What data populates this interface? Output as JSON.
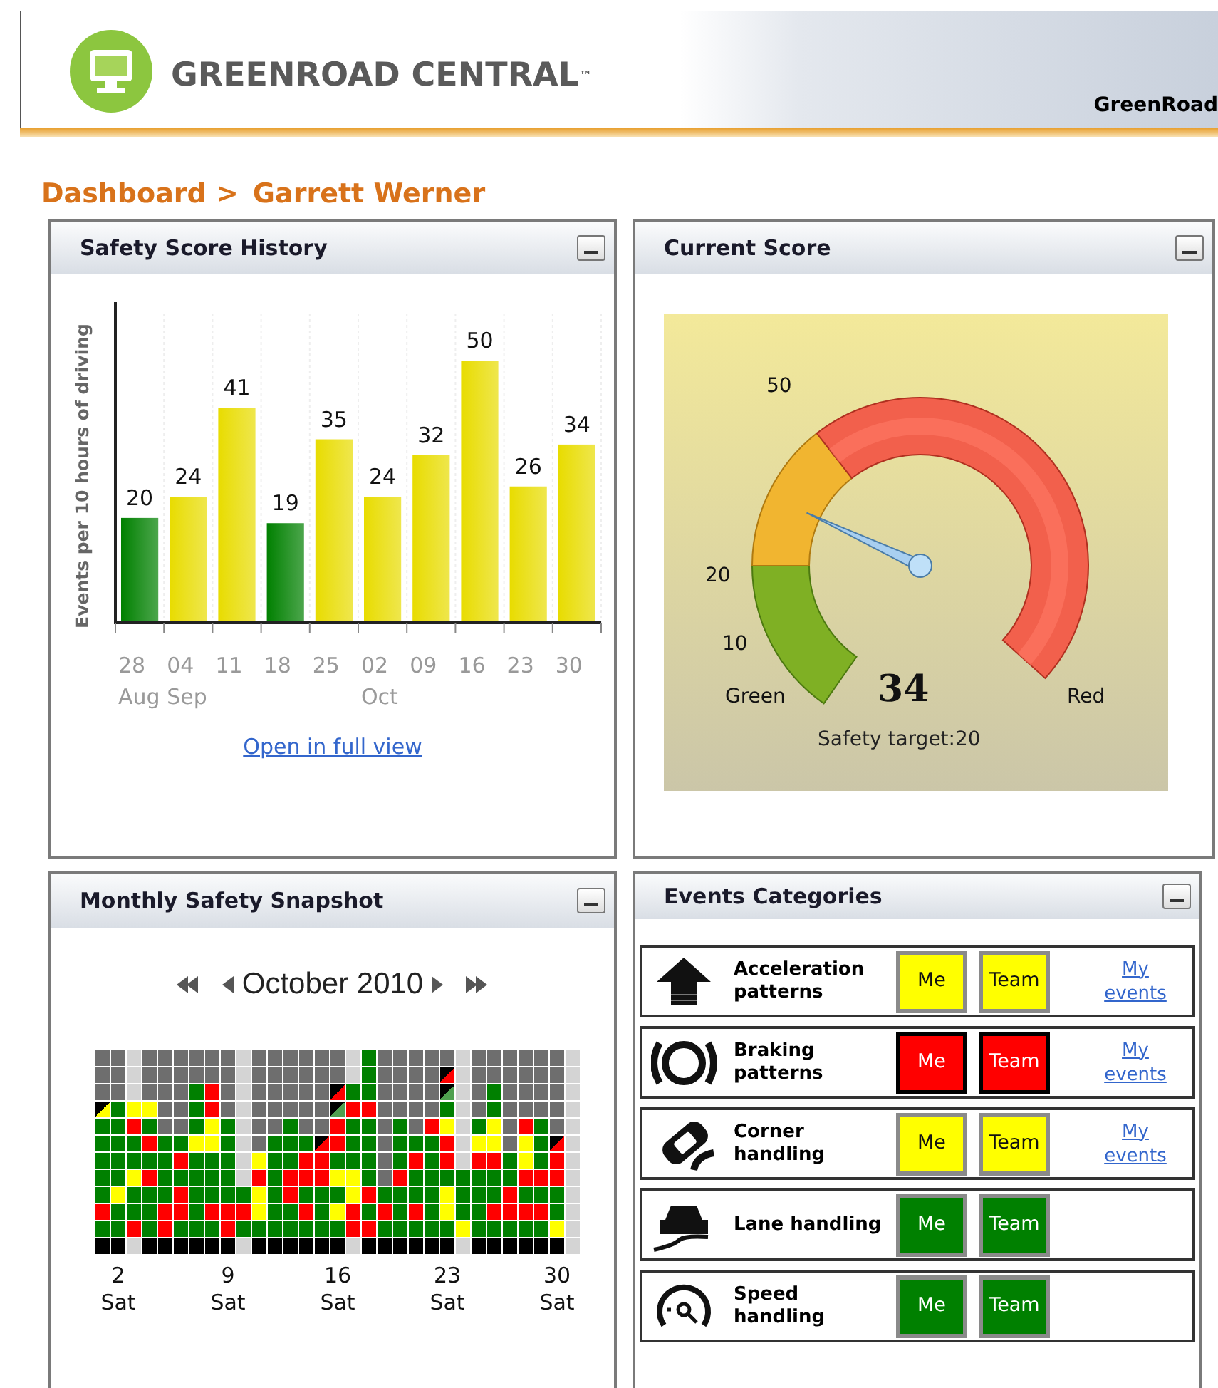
{
  "header": {
    "logo_text": "GREENROAD CENTRAL",
    "trademark": "™",
    "account": "GreenRoad"
  },
  "breadcrumb": [
    "Dashboard >",
    "Garrett Werner"
  ],
  "safety_score_history": {
    "title": "Safety Score History",
    "link": "Open in full view",
    "chart_data": {
      "type": "bar",
      "ylabel": "Events per 10 hours of driving",
      "categories": [
        "28\nAug",
        "04\nSep",
        "11",
        "18",
        "25",
        "02\nOct",
        "09",
        "16",
        "23",
        "30"
      ],
      "data_labels": true,
      "ylim": [
        0,
        59
      ],
      "series": [
        {
          "color": "#008000",
          "values": [
            20,
            null,
            null,
            19,
            null,
            null,
            null,
            null,
            null,
            null
          ]
        },
        {
          "color": "#e8dc00",
          "values": [
            null,
            24,
            41,
            null,
            35,
            24,
            32,
            50,
            26,
            34
          ]
        }
      ]
    }
  },
  "current_score": {
    "title": "Current Score",
    "ticks": [
      {
        "label": "50"
      },
      {
        "label": "20"
      },
      {
        "label": "10"
      }
    ],
    "left_label": "Green",
    "right_label": "Red",
    "score": "34",
    "target": "Safety target:20"
  },
  "monthly_snapshot": {
    "title": "Monthly Safety Snapshot",
    "month": "October 2010",
    "rows": [
      [
        {
          "color": "#6e6e6e"
        },
        {
          "color": "#6e6e6e"
        },
        {
          "color": "#d4d4d4"
        },
        {
          "color": "#6e6e6e"
        },
        {
          "color": "#6e6e6e"
        },
        {
          "color": "#6e6e6e"
        },
        {
          "color": "#6e6e6e"
        },
        {
          "color": "#6e6e6e"
        },
        {
          "color": "#6e6e6e"
        },
        {
          "color": "#d4d4d4"
        },
        {
          "color": "#6e6e6e"
        },
        {
          "color": "#6e6e6e"
        },
        {
          "color": "#6e6e6e"
        },
        {
          "color": "#6e6e6e"
        },
        {
          "color": "#6e6e6e"
        },
        {
          "color": "#6e6e6e"
        },
        {
          "color": "#d4d4d4"
        },
        {
          "color": "#008000"
        },
        {
          "color": "#6e6e6e"
        },
        {
          "color": "#6e6e6e"
        },
        {
          "color": "#6e6e6e"
        },
        {
          "color": "#6e6e6e"
        },
        {
          "color": "#6e6e6e"
        },
        {
          "color": "#d4d4d4"
        },
        {
          "color": "#6e6e6e"
        },
        {
          "color": "#6e6e6e"
        },
        {
          "color": "#6e6e6e"
        },
        {
          "color": "#6e6e6e"
        },
        {
          "color": "#6e6e6e"
        },
        {
          "color": "#6e6e6e"
        },
        {
          "color": "#d4d4d4"
        }
      ],
      [
        {
          "color": "#6e6e6e"
        },
        {
          "color": "#6e6e6e"
        },
        {
          "color": "#d4d4d4"
        },
        {
          "color": "#6e6e6e"
        },
        {
          "color": "#6e6e6e"
        },
        {
          "color": "#6e6e6e"
        },
        {
          "color": "#6e6e6e"
        },
        {
          "color": "#6e6e6e"
        },
        {
          "color": "#6e6e6e"
        },
        {
          "color": "#d4d4d4"
        },
        {
          "color": "#6e6e6e"
        },
        {
          "color": "#6e6e6e"
        },
        {
          "color": "#6e6e6e"
        },
        {
          "color": "#6e6e6e"
        },
        {
          "color": "#6e6e6e"
        },
        {
          "color": "#6e6e6e"
        },
        {
          "color": "#d4d4d4"
        },
        {
          "color": "#008000"
        },
        {
          "color": "#6e6e6e"
        },
        {
          "color": "#6e6e6e"
        },
        {
          "color": "#6e6e6e"
        },
        {
          "color": "#6e6e6e"
        },
        {
          "color": "#ff0000",
          "corner": true
        },
        {
          "color": "#d4d4d4"
        },
        {
          "color": "#6e6e6e"
        },
        {
          "color": "#6e6e6e"
        },
        {
          "color": "#6e6e6e"
        },
        {
          "color": "#6e6e6e"
        },
        {
          "color": "#6e6e6e"
        },
        {
          "color": "#6e6e6e"
        },
        {
          "color": "#d4d4d4"
        }
      ],
      [
        {
          "color": "#6e6e6e"
        },
        {
          "color": "#6e6e6e"
        },
        {
          "color": "#d4d4d4"
        },
        {
          "color": "#6e6e6e"
        },
        {
          "color": "#6e6e6e"
        },
        {
          "color": "#6e6e6e"
        },
        {
          "color": "#008000"
        },
        {
          "color": "#ff0000"
        },
        {
          "color": "#6e6e6e"
        },
        {
          "color": "#d4d4d4"
        },
        {
          "color": "#6e6e6e"
        },
        {
          "color": "#6e6e6e"
        },
        {
          "color": "#6e6e6e"
        },
        {
          "color": "#6e6e6e"
        },
        {
          "color": "#6e6e6e"
        },
        {
          "color": "#ff0000",
          "corner": true
        },
        {
          "color": "#008000"
        },
        {
          "color": "#008000"
        },
        {
          "color": "#6e6e6e"
        },
        {
          "color": "#6e6e6e"
        },
        {
          "color": "#6e6e6e"
        },
        {
          "color": "#6e6e6e"
        },
        {
          "color": "#50a050",
          "corner": true
        },
        {
          "color": "#d4d4d4"
        },
        {
          "color": "#6e6e6e"
        },
        {
          "color": "#008000"
        },
        {
          "color": "#6e6e6e"
        },
        {
          "color": "#6e6e6e"
        },
        {
          "color": "#6e6e6e"
        },
        {
          "color": "#6e6e6e"
        },
        {
          "color": "#d4d4d4"
        }
      ],
      [
        {
          "color": "#ffff00",
          "corner": true
        },
        {
          "color": "#008000"
        },
        {
          "color": "#ffff00"
        },
        {
          "color": "#ffff00"
        },
        {
          "color": "#6e6e6e"
        },
        {
          "color": "#6e6e6e"
        },
        {
          "color": "#008000"
        },
        {
          "color": "#ff0000"
        },
        {
          "color": "#6e6e6e"
        },
        {
          "color": "#d4d4d4"
        },
        {
          "color": "#6e6e6e"
        },
        {
          "color": "#6e6e6e"
        },
        {
          "color": "#6e6e6e"
        },
        {
          "color": "#6e6e6e"
        },
        {
          "color": "#6e6e6e"
        },
        {
          "color": "#50a050",
          "corner": true
        },
        {
          "color": "#ff0000"
        },
        {
          "color": "#ff0000"
        },
        {
          "color": "#6e6e6e"
        },
        {
          "color": "#6e6e6e"
        },
        {
          "color": "#6e6e6e"
        },
        {
          "color": "#6e6e6e"
        },
        {
          "color": "#008000"
        },
        {
          "color": "#d4d4d4"
        },
        {
          "color": "#6e6e6e"
        },
        {
          "color": "#008000"
        },
        {
          "color": "#6e6e6e"
        },
        {
          "color": "#6e6e6e"
        },
        {
          "color": "#6e6e6e"
        },
        {
          "color": "#6e6e6e"
        },
        {
          "color": "#d4d4d4"
        }
      ],
      [
        {
          "color": "#008000"
        },
        {
          "color": "#008000"
        },
        {
          "color": "#ff0000"
        },
        {
          "color": "#008000"
        },
        {
          "color": "#6e6e6e"
        },
        {
          "color": "#6e6e6e"
        },
        {
          "color": "#008000"
        },
        {
          "color": "#ffff00"
        },
        {
          "color": "#008000"
        },
        {
          "color": "#d4d4d4"
        },
        {
          "color": "#6e6e6e"
        },
        {
          "color": "#6e6e6e"
        },
        {
          "color": "#008000"
        },
        {
          "color": "#6e6e6e"
        },
        {
          "color": "#6e6e6e"
        },
        {
          "color": "#ff0000"
        },
        {
          "color": "#008000"
        },
        {
          "color": "#008000"
        },
        {
          "color": "#6e6e6e"
        },
        {
          "color": "#008000"
        },
        {
          "color": "#6e6e6e"
        },
        {
          "color": "#ff0000"
        },
        {
          "color": "#ffff00"
        },
        {
          "color": "#d4d4d4"
        },
        {
          "color": "#008000"
        },
        {
          "color": "#ffff00"
        },
        {
          "color": "#6e6e6e"
        },
        {
          "color": "#ff0000"
        },
        {
          "color": "#008000"
        },
        {
          "color": "#6e6e6e"
        },
        {
          "color": "#d4d4d4"
        }
      ],
      [
        {
          "color": "#008000"
        },
        {
          "color": "#008000"
        },
        {
          "color": "#008000"
        },
        {
          "color": "#ff0000"
        },
        {
          "color": "#008000"
        },
        {
          "color": "#008000"
        },
        {
          "color": "#ffff00"
        },
        {
          "color": "#ffff00"
        },
        {
          "color": "#008000"
        },
        {
          "color": "#d4d4d4"
        },
        {
          "color": "#6e6e6e"
        },
        {
          "color": "#008000"
        },
        {
          "color": "#008000"
        },
        {
          "color": "#008000"
        },
        {
          "color": "#ff0000",
          "corner": true
        },
        {
          "color": "#ff0000"
        },
        {
          "color": "#008000"
        },
        {
          "color": "#008000"
        },
        {
          "color": "#6e6e6e"
        },
        {
          "color": "#008000"
        },
        {
          "color": "#008000"
        },
        {
          "color": "#008000"
        },
        {
          "color": "#ff0000"
        },
        {
          "color": "#d4d4d4"
        },
        {
          "color": "#ffff00"
        },
        {
          "color": "#ffff00"
        },
        {
          "color": "#6e6e6e"
        },
        {
          "color": "#ffff00"
        },
        {
          "color": "#008000"
        },
        {
          "color": "#ff0000",
          "corner": true
        },
        {
          "color": "#d4d4d4"
        }
      ],
      [
        {
          "color": "#008000"
        },
        {
          "color": "#008000"
        },
        {
          "color": "#008000"
        },
        {
          "color": "#008000"
        },
        {
          "color": "#008000"
        },
        {
          "color": "#ff0000"
        },
        {
          "color": "#008000"
        },
        {
          "color": "#008000"
        },
        {
          "color": "#008000"
        },
        {
          "color": "#d4d4d4"
        },
        {
          "color": "#ffff00"
        },
        {
          "color": "#008000"
        },
        {
          "color": "#008000"
        },
        {
          "color": "#ff0000"
        },
        {
          "color": "#ff0000"
        },
        {
          "color": "#008000"
        },
        {
          "color": "#008000"
        },
        {
          "color": "#008000"
        },
        {
          "color": "#6e6e6e"
        },
        {
          "color": "#008000"
        },
        {
          "color": "#ff0000"
        },
        {
          "color": "#008000"
        },
        {
          "color": "#ff0000"
        },
        {
          "color": "#d4d4d4"
        },
        {
          "color": "#ff0000"
        },
        {
          "color": "#ff0000"
        },
        {
          "color": "#008000"
        },
        {
          "color": "#ffff00"
        },
        {
          "color": "#008000"
        },
        {
          "color": "#ff0000"
        },
        {
          "color": "#d4d4d4"
        }
      ],
      [
        {
          "color": "#008000"
        },
        {
          "color": "#008000"
        },
        {
          "color": "#ffff00"
        },
        {
          "color": "#ff0000"
        },
        {
          "color": "#008000"
        },
        {
          "color": "#008000"
        },
        {
          "color": "#008000"
        },
        {
          "color": "#008000"
        },
        {
          "color": "#008000"
        },
        {
          "color": "#d4d4d4"
        },
        {
          "color": "#ff0000"
        },
        {
          "color": "#008000"
        },
        {
          "color": "#ff0000"
        },
        {
          "color": "#ff0000"
        },
        {
          "color": "#ff0000"
        },
        {
          "color": "#ffff00"
        },
        {
          "color": "#ffff00"
        },
        {
          "color": "#008000"
        },
        {
          "color": "#6e6e6e"
        },
        {
          "color": "#ff0000"
        },
        {
          "color": "#008000"
        },
        {
          "color": "#008000"
        },
        {
          "color": "#008000"
        },
        {
          "color": "#008000"
        },
        {
          "color": "#008000"
        },
        {
          "color": "#008000"
        },
        {
          "color": "#008000"
        },
        {
          "color": "#ff0000"
        },
        {
          "color": "#ff0000"
        },
        {
          "color": "#ff0000"
        },
        {
          "color": "#d4d4d4"
        }
      ],
      [
        {
          "color": "#008000"
        },
        {
          "color": "#ffff00"
        },
        {
          "color": "#008000"
        },
        {
          "color": "#008000"
        },
        {
          "color": "#008000"
        },
        {
          "color": "#ff0000"
        },
        {
          "color": "#008000"
        },
        {
          "color": "#008000"
        },
        {
          "color": "#008000"
        },
        {
          "color": "#008000"
        },
        {
          "color": "#ffff00"
        },
        {
          "color": "#008000"
        },
        {
          "color": "#ff0000"
        },
        {
          "color": "#008000"
        },
        {
          "color": "#008000"
        },
        {
          "color": "#008000"
        },
        {
          "color": "#ffff00"
        },
        {
          "color": "#ff0000"
        },
        {
          "color": "#008000"
        },
        {
          "color": "#008000"
        },
        {
          "color": "#008000"
        },
        {
          "color": "#008000"
        },
        {
          "color": "#ffff00"
        },
        {
          "color": "#008000"
        },
        {
          "color": "#008000"
        },
        {
          "color": "#008000"
        },
        {
          "color": "#ff0000"
        },
        {
          "color": "#008000"
        },
        {
          "color": "#008000"
        },
        {
          "color": "#008000"
        },
        {
          "color": "#d4d4d4"
        }
      ],
      [
        {
          "color": "#ff0000"
        },
        {
          "color": "#008000"
        },
        {
          "color": "#008000"
        },
        {
          "color": "#008000"
        },
        {
          "color": "#ff0000"
        },
        {
          "color": "#ff0000"
        },
        {
          "color": "#008000"
        },
        {
          "color": "#ff0000"
        },
        {
          "color": "#ff0000"
        },
        {
          "color": "#ff0000"
        },
        {
          "color": "#ffff00"
        },
        {
          "color": "#008000"
        },
        {
          "color": "#008000"
        },
        {
          "color": "#ff0000"
        },
        {
          "color": "#008000"
        },
        {
          "color": "#ffff00"
        },
        {
          "color": "#ff0000"
        },
        {
          "color": "#008000"
        },
        {
          "color": "#ff0000"
        },
        {
          "color": "#008000"
        },
        {
          "color": "#ff0000"
        },
        {
          "color": "#008000"
        },
        {
          "color": "#ffff00"
        },
        {
          "color": "#008000"
        },
        {
          "color": "#008000"
        },
        {
          "color": "#ff0000"
        },
        {
          "color": "#ff0000"
        },
        {
          "color": "#ff0000"
        },
        {
          "color": "#ff0000"
        },
        {
          "color": "#008000"
        },
        {
          "color": "#d4d4d4"
        }
      ],
      [
        {
          "color": "#008000"
        },
        {
          "color": "#008000"
        },
        {
          "color": "#ff0000"
        },
        {
          "color": "#008000"
        },
        {
          "color": "#ff0000"
        },
        {
          "color": "#008000"
        },
        {
          "color": "#008000"
        },
        {
          "color": "#008000"
        },
        {
          "color": "#ff0000"
        },
        {
          "color": "#008000"
        },
        {
          "color": "#008000"
        },
        {
          "color": "#008000"
        },
        {
          "color": "#008000"
        },
        {
          "color": "#008000"
        },
        {
          "color": "#008000"
        },
        {
          "color": "#008000"
        },
        {
          "color": "#ff0000"
        },
        {
          "color": "#ff0000"
        },
        {
          "color": "#008000"
        },
        {
          "color": "#008000"
        },
        {
          "color": "#008000"
        },
        {
          "color": "#008000"
        },
        {
          "color": "#008000"
        },
        {
          "color": "#ffff00"
        },
        {
          "color": "#008000"
        },
        {
          "color": "#008000"
        },
        {
          "color": "#008000"
        },
        {
          "color": "#008000"
        },
        {
          "color": "#008000"
        },
        {
          "color": "#ffff00"
        },
        {
          "color": "#d4d4d4"
        }
      ],
      [
        {
          "color": "#000000"
        },
        {
          "color": "#000000",
          "day": "2",
          "weekday": "Sat"
        },
        {
          "color": "#d4d4d4"
        },
        {
          "color": "#000000"
        },
        {
          "color": "#000000"
        },
        {
          "color": "#000000"
        },
        {
          "color": "#000000"
        },
        {
          "color": "#000000"
        },
        {
          "color": "#000000",
          "day": "9",
          "weekday": "Sat"
        },
        {
          "color": "#d4d4d4"
        },
        {
          "color": "#000000"
        },
        {
          "color": "#000000"
        },
        {
          "color": "#000000"
        },
        {
          "color": "#000000"
        },
        {
          "color": "#000000"
        },
        {
          "color": "#000000",
          "day": "16",
          "weekday": "Sat"
        },
        {
          "color": "#d4d4d4"
        },
        {
          "color": "#000000"
        },
        {
          "color": "#000000"
        },
        {
          "color": "#000000"
        },
        {
          "color": "#000000"
        },
        {
          "color": "#000000"
        },
        {
          "color": "#000000",
          "day": "23",
          "weekday": "Sat"
        },
        {
          "color": "#d4d4d4"
        },
        {
          "color": "#000000"
        },
        {
          "color": "#000000"
        },
        {
          "color": "#000000"
        },
        {
          "color": "#000000"
        },
        {
          "color": "#000000"
        },
        {
          "color": "#000000",
          "day": "30",
          "weekday": "Sat"
        },
        {
          "color": "#d4d4d4"
        }
      ]
    ]
  },
  "events_categories": {
    "title": "Events Categories",
    "rows": [
      {
        "kind": "acceleration",
        "label": "Acceleration patterns",
        "me": {
          "text": "Me",
          "color": "#ffff00"
        },
        "team": {
          "text": "Team",
          "color": "#ffff00"
        },
        "link": "My events"
      },
      {
        "kind": "braking",
        "label": "Braking patterns",
        "me": {
          "text": "Me",
          "color": "#ff0000"
        },
        "team": {
          "text": "Team",
          "color": "#ff0000"
        },
        "link": "My events"
      },
      {
        "kind": "corner",
        "label": "Corner handling",
        "me": {
          "text": "Me",
          "color": "#ffff00"
        },
        "team": {
          "text": "Team",
          "color": "#ffff00"
        },
        "link": "My events"
      },
      {
        "kind": "lane",
        "label": "Lane handling",
        "me": {
          "text": "Me",
          "color": "#008000"
        },
        "team": {
          "text": "Team",
          "color": "#008000"
        }
      },
      {
        "kind": "speed",
        "label": "Speed handling",
        "me": {
          "text": "Me",
          "color": "#008000"
        },
        "team": {
          "text": "Team",
          "color": "#008000"
        }
      }
    ]
  }
}
